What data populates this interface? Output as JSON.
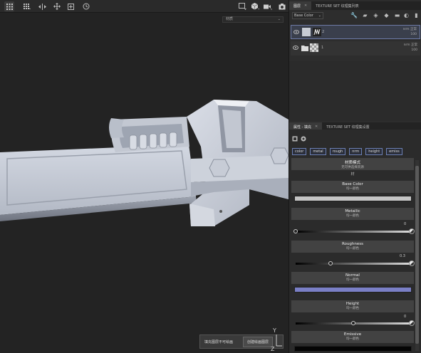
{
  "toolbar": {
    "left_icons": [
      "grid-view-icon",
      "grid-dots-icon",
      "symmetry-icon",
      "transform-icon",
      "add-layer-icon",
      "history-icon"
    ],
    "right_icons": [
      "display-icon",
      "cube-icon",
      "camera-icon",
      "screenshot-icon"
    ]
  },
  "viewport": {
    "material_dropdown": "材质",
    "hint_message": "填充图层不可绘画",
    "hint_button": "创建绘画图层",
    "axis_y": "Y",
    "axis_z": "Z"
  },
  "layers_panel": {
    "tabs": [
      {
        "label": "图层",
        "active": true
      },
      {
        "label": "TEXTURE SET 纹理集列表",
        "active": false
      }
    ],
    "channel_select": "Base Color",
    "tool_icons": [
      "wrench-icon",
      "brush-icon",
      "fill-icon",
      "bucket-icon",
      "folder-icon",
      "mask-icon",
      "trash-icon"
    ],
    "layers": [
      {
        "name": "2",
        "blend_mode": "nrm 正常",
        "opacity": "100",
        "selected": true,
        "visible": true
      },
      {
        "name": "1",
        "blend_mode": "nrm 正常",
        "opacity": "100",
        "selected": false,
        "visible": true
      }
    ]
  },
  "properties_panel": {
    "tabs": [
      {
        "label": "属性 - 填充",
        "active": true
      },
      {
        "label": "TEXTURE SET 纹理集设置",
        "active": false
      }
    ],
    "channel_chips": [
      "color",
      "metal",
      "rough",
      "nrm",
      "height",
      "emiss"
    ],
    "material_mode": {
      "title": "材质模式",
      "subtitle": "无可供选择资源"
    },
    "material_label": "材",
    "channels": [
      {
        "name": "Base Color",
        "sub": "均一颜色",
        "type": "color",
        "color": "#c4c4c4"
      },
      {
        "name": "Metallic",
        "sub": "均一颜色",
        "type": "slider",
        "value": "0",
        "fraction": 0.0
      },
      {
        "name": "Roughness",
        "sub": "均一颜色",
        "type": "slider",
        "value": "0.3",
        "fraction": 0.3
      },
      {
        "name": "Normal",
        "sub": "均一颜色",
        "type": "color",
        "color": "#7a7fc6"
      },
      {
        "name": "Height",
        "sub": "均一颜色",
        "type": "slider",
        "value": "0",
        "fraction": 0.5
      },
      {
        "name": "Emissive",
        "sub": "均一颜色",
        "type": "color",
        "color": "#050505"
      }
    ]
  }
}
